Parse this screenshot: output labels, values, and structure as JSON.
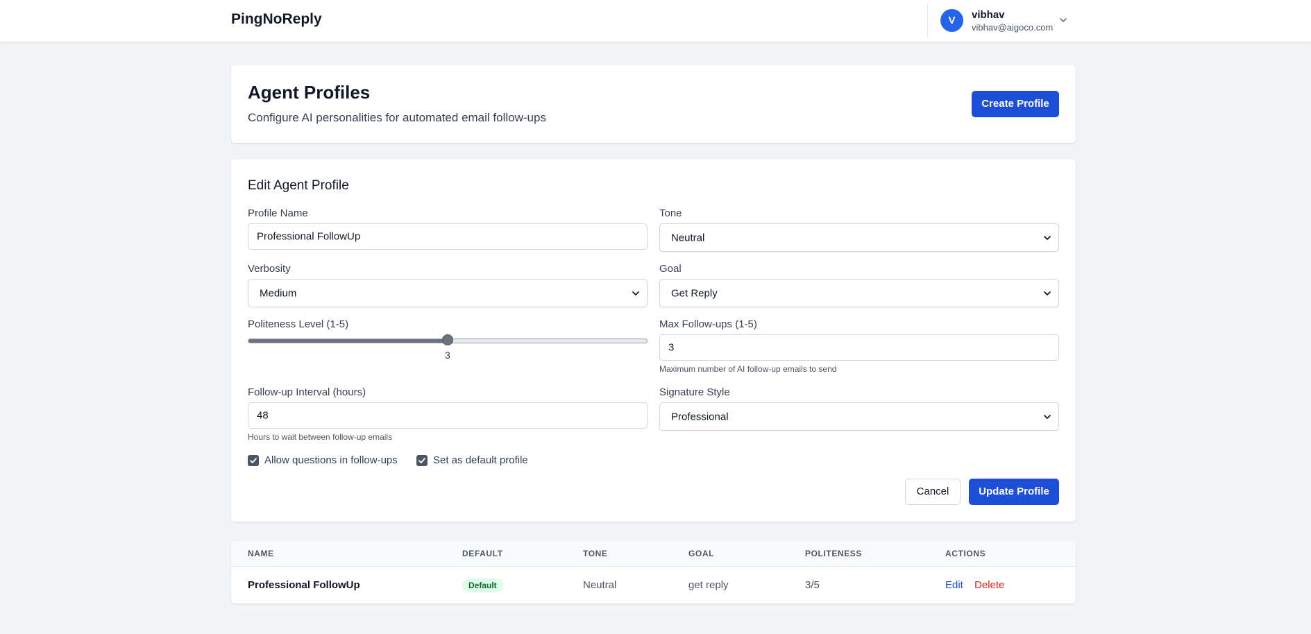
{
  "app": {
    "brand": "PingNoReply"
  },
  "user": {
    "initial": "V",
    "name": "vibhav",
    "email": "vibhav@aigoco.com"
  },
  "header": {
    "title": "Agent Profiles",
    "subtitle": "Configure AI personalities for automated email follow-ups",
    "create_label": "Create Profile"
  },
  "form": {
    "title": "Edit Agent Profile",
    "profile_name": {
      "label": "Profile Name",
      "value": "Professional FollowUp"
    },
    "tone": {
      "label": "Tone",
      "value": "Neutral"
    },
    "verbosity": {
      "label": "Verbosity",
      "value": "Medium"
    },
    "goal": {
      "label": "Goal",
      "value": "Get Reply"
    },
    "politeness": {
      "label": "Politeness Level (1-5)",
      "value": "3",
      "level": 3,
      "min": 1,
      "max": 5
    },
    "max_followups": {
      "label": "Max Follow-ups (1-5)",
      "value": "3",
      "help": "Maximum number of AI follow-up emails to send"
    },
    "interval": {
      "label": "Follow-up Interval (hours)",
      "value": "48",
      "help": "Hours to wait between follow-up emails"
    },
    "signature": {
      "label": "Signature Style",
      "value": "Professional"
    },
    "allow_questions": {
      "label": "Allow questions in follow-ups",
      "checked": true
    },
    "set_default": {
      "label": "Set as default profile",
      "checked": true
    },
    "cancel_label": "Cancel",
    "update_label": "Update Profile"
  },
  "table": {
    "columns": [
      "NAME",
      "DEFAULT",
      "TONE",
      "GOAL",
      "POLITENESS",
      "ACTIONS"
    ],
    "rows": [
      {
        "name": "Professional FollowUp",
        "default_badge": "Default",
        "tone": "Neutral",
        "goal": "get reply",
        "politeness": "3/5",
        "edit_label": "Edit",
        "delete_label": "Delete"
      }
    ]
  },
  "colors": {
    "primary": "#1d4ed8",
    "danger": "#dc2626",
    "badge_bg": "#dcfce7",
    "badge_text": "#166534"
  }
}
